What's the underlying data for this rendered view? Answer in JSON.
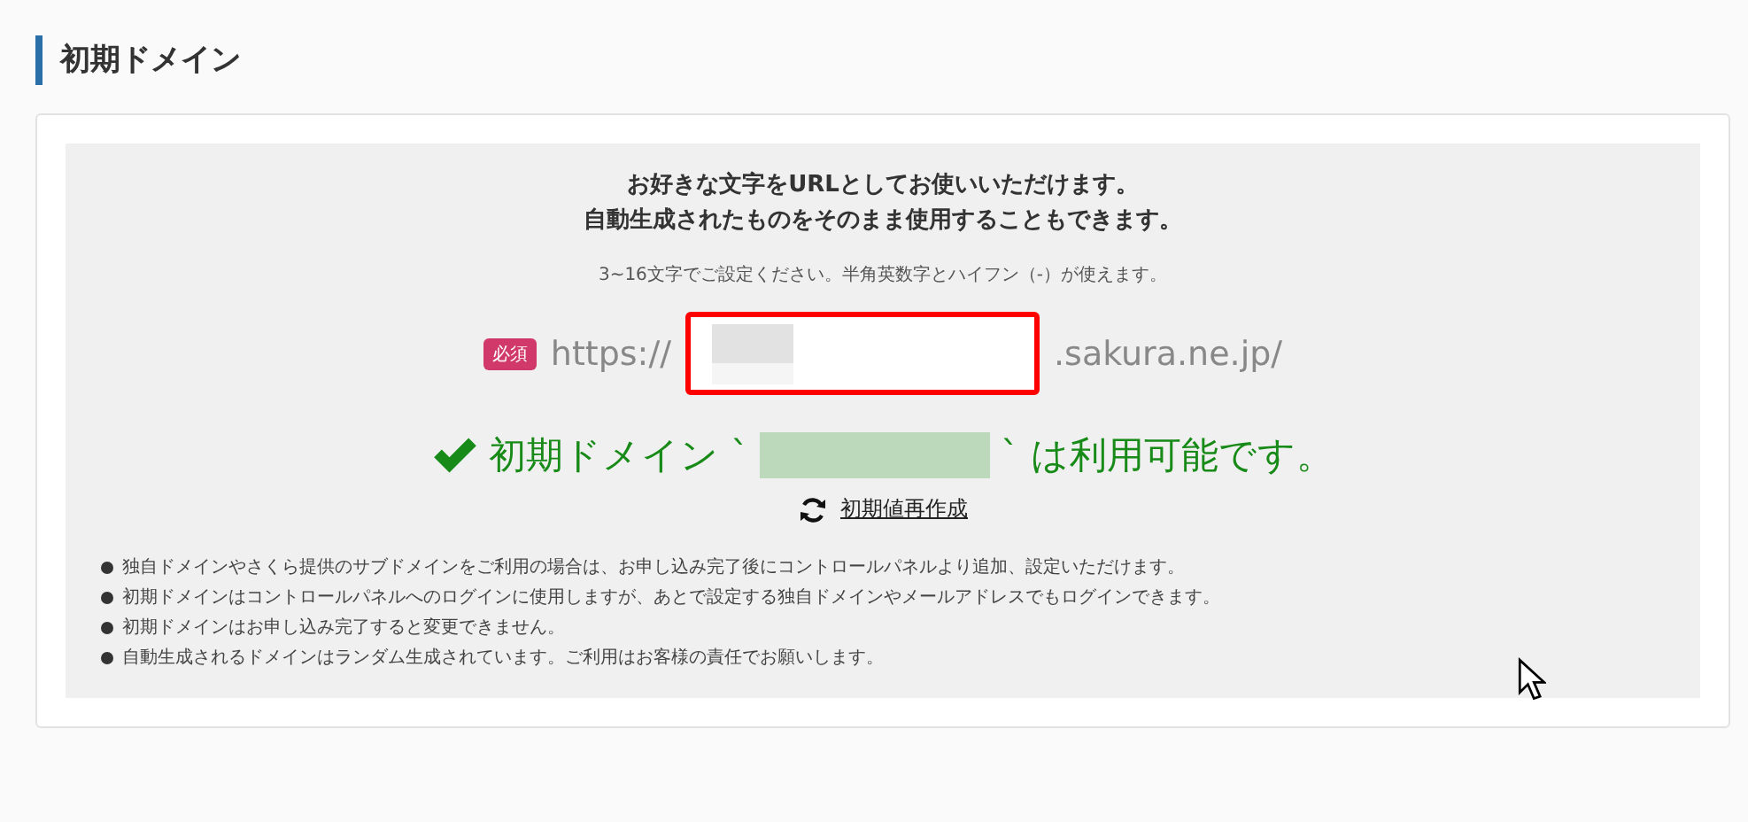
{
  "section_title": "初期ドメイン",
  "intro": [
    "お好きな文字をURLとしてお使いいただけます。",
    "自動生成されたものをそのまま使用することもできます。"
  ],
  "hint": "3~16文字でご設定ください。半角英数字とハイフン（-）が使えます。",
  "domain_field": {
    "required_badge": "必須",
    "prefix": "https://",
    "suffix": ".sakura.ne.jp/",
    "error": true
  },
  "availability": {
    "ok": true,
    "before": "初期ドメイン `",
    "after": "` は利用可能です。"
  },
  "regenerate_link": "初期値再作成",
  "notes": [
    "独自ドメインやさくら提供のサブドメインをご利用の場合は、お申し込み完了後にコントロールパネルより追加、設定いただけます。",
    "初期ドメインはコントロールパネルへのログインに使用しますが、あとで設定する独自ドメインやメールアドレスでもログインできます。",
    "初期ドメインはお申し込み完了すると変更できません。",
    "自動生成されるドメインはランダム生成されています。ご利用はお客様の責任でお願いします。"
  ]
}
